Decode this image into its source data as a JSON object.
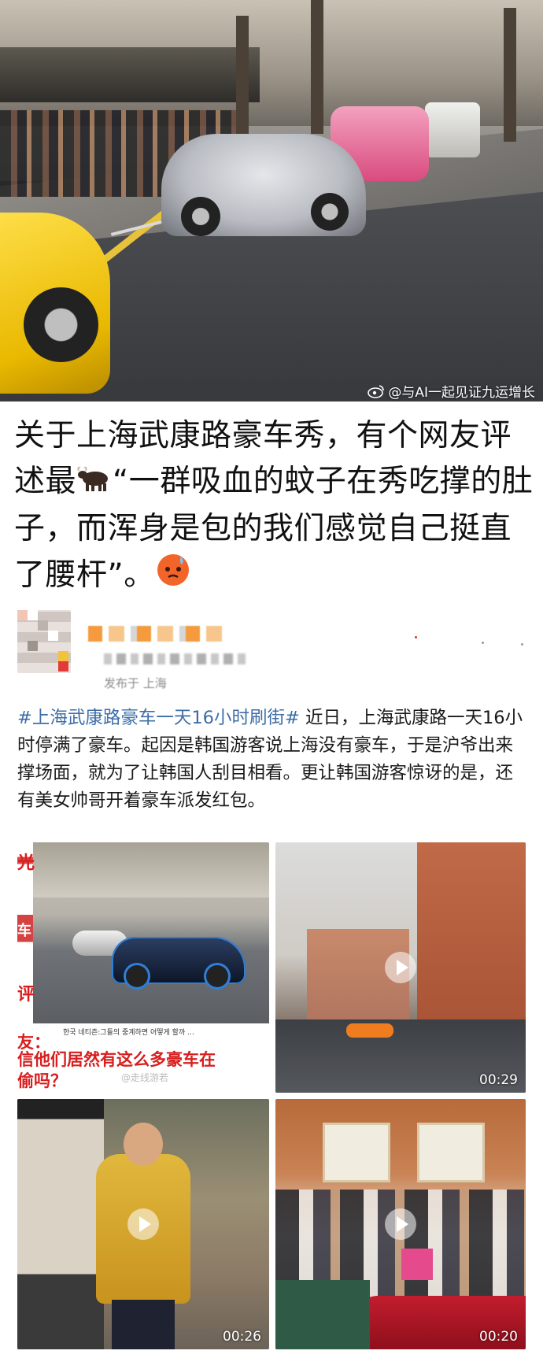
{
  "hero": {
    "watermark": "@与AI一起见证九运增长",
    "watermark_icon": "weibo-icon"
  },
  "caption": {
    "part1": "关于上海武康路豪车秀，有个网友评述最",
    "emoji1": "ox-emoji",
    "part2": "“一群吸血的蚊子在秀吃撑的肚子，而浑身是包的我们感觉自己挺直了腰杆”。",
    "emoji2": "worried-face-emoji"
  },
  "post": {
    "location": "发布于 上海",
    "hashtag": "#上海武康路豪车一天16小时刷街#",
    "body": " 近日，上海武康路一天16小时停满了豪车。起因是韩国游客说上海没有豪车，于是沪爷出来撑场面，就为了让韩国人刮目相看。更让韩国游客惊讶的是，还有美女帅哥开着豪车派发红包。"
  },
  "media": [
    {
      "type": "image",
      "overlay_left_chars": [
        "光",
        "车",
        "评"
      ],
      "tiny_text": "한국 네티즌:그들의 중계하면 어떻게 할까 ...",
      "overlay_line1": "友：",
      "overlay_line2": "信他们居然有这么多豪车在",
      "overlay_line3": "偷吗？",
      "watermark": "@走线游若"
    },
    {
      "type": "video",
      "duration": "00:29"
    },
    {
      "type": "video",
      "duration": "00:26"
    },
    {
      "type": "video",
      "duration": "00:20"
    }
  ],
  "colors": {
    "hashtag": "#3e6ea8",
    "caption_text": "#111111",
    "overlay_red": "#d81e1e"
  }
}
